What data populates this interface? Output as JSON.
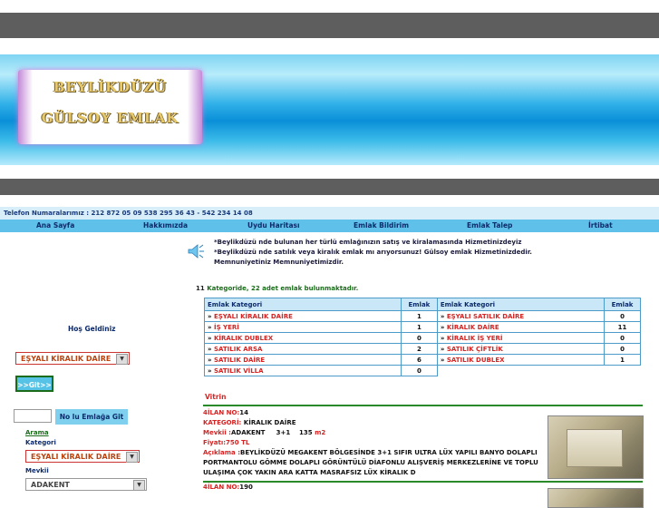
{
  "brand": {
    "line1": "BEYLİKDÜZÜ",
    "line2": "GÜLSOY EMLAK"
  },
  "phone_text": "Telefon Numaralarımız : 212 872 05 09    538 295 36 43 - 542 234 14 08",
  "nav": [
    "Ana Sayfa",
    "Hakkımızda",
    "Uydu Haritası",
    "Emlak Bildirim",
    "Emlak Talep",
    "İrtibat"
  ],
  "intro": [
    "*Beylikdüzü nde bulunan her türlü emlağınızın satış ve kiralamasında Hizmetinizdeyiz",
    "*Beylikdüzü nde satılık veya kiralık emlak mı arıyorsunuz! Gülsoy emlak Hizmetinizdedir.",
    "Memnuniyetiniz Memnuniyetimizdir."
  ],
  "count_text": {
    "prefix": "11",
    "rest": "Kategoride, 22 adet emlak bulunmaktadır."
  },
  "categories": {
    "header_cat": "Emlak Kategori",
    "header_count": "Emlak",
    "left": [
      {
        "name": "EŞYALI KİRALIK DAİRE",
        "count": "1"
      },
      {
        "name": "İŞ YERİ",
        "count": "1"
      },
      {
        "name": "KİRALIK DUBLEX",
        "count": "0"
      },
      {
        "name": "SATILIK ARSA",
        "count": "2"
      },
      {
        "name": "SATILIK DAİRE",
        "count": "6"
      },
      {
        "name": "SATILIK VİLLA",
        "count": "0"
      }
    ],
    "right": [
      {
        "name": "EŞYALI SATILIK DAİRE",
        "count": "0"
      },
      {
        "name": "KİRALIK DAİRE",
        "count": "11"
      },
      {
        "name": "KİRALIK İŞ YERİ",
        "count": "0"
      },
      {
        "name": "SATILIK ÇİFTLİK",
        "count": "0"
      },
      {
        "name": "SATILIK DUBLEX",
        "count": "1"
      }
    ]
  },
  "vitrin_label": "Vitrin",
  "listing1": {
    "ilan_label": "4İLAN NO:",
    "ilan_no": "14",
    "kategori_label": "KATEGORİ:",
    "kategori": " KİRALIK DAİRE",
    "mevkii_label": "Mevkii :",
    "mevkii": "ADAKENT",
    "rooms": "3+1",
    "size": "135",
    "size_unit": "m2",
    "fiyat_label": "Fiyatı:",
    "fiyat": "750 TL",
    "aciklama_label": "Açıklama :",
    "aciklama": "BEYLİKDÜZÜ MEGAKENT BÖLGESİNDE 3+1 SIFIR ULTRA LÜX YAPILI BANYO DOLAPLI PORTMANTOLU GÖMME DOLAPLI GÖRÜNTÜLÜ DİAFONLU ALIŞVERİŞ MERKEZLERİNE VE TOPLU ULAŞIMA ÇOK YAKIN ARA KATTA MASRAFSIZ LÜX KİRALIK D"
  },
  "listing2": {
    "ilan_label": "4İLAN NO:",
    "ilan_no": "190"
  },
  "sidebar": {
    "welcome": "Hoş Geldiniz",
    "select1": "EŞYALI KİRALIK DAİRE",
    "git_button": ">>Git>>",
    "no_button": "No lu Emlağa Git",
    "arama": "Arama",
    "kategori_label": "Kategori",
    "select2": "EŞYALI KİRALIK DAİRE",
    "mevkii_label": "Mevkii",
    "select3": "ADAKENT"
  }
}
